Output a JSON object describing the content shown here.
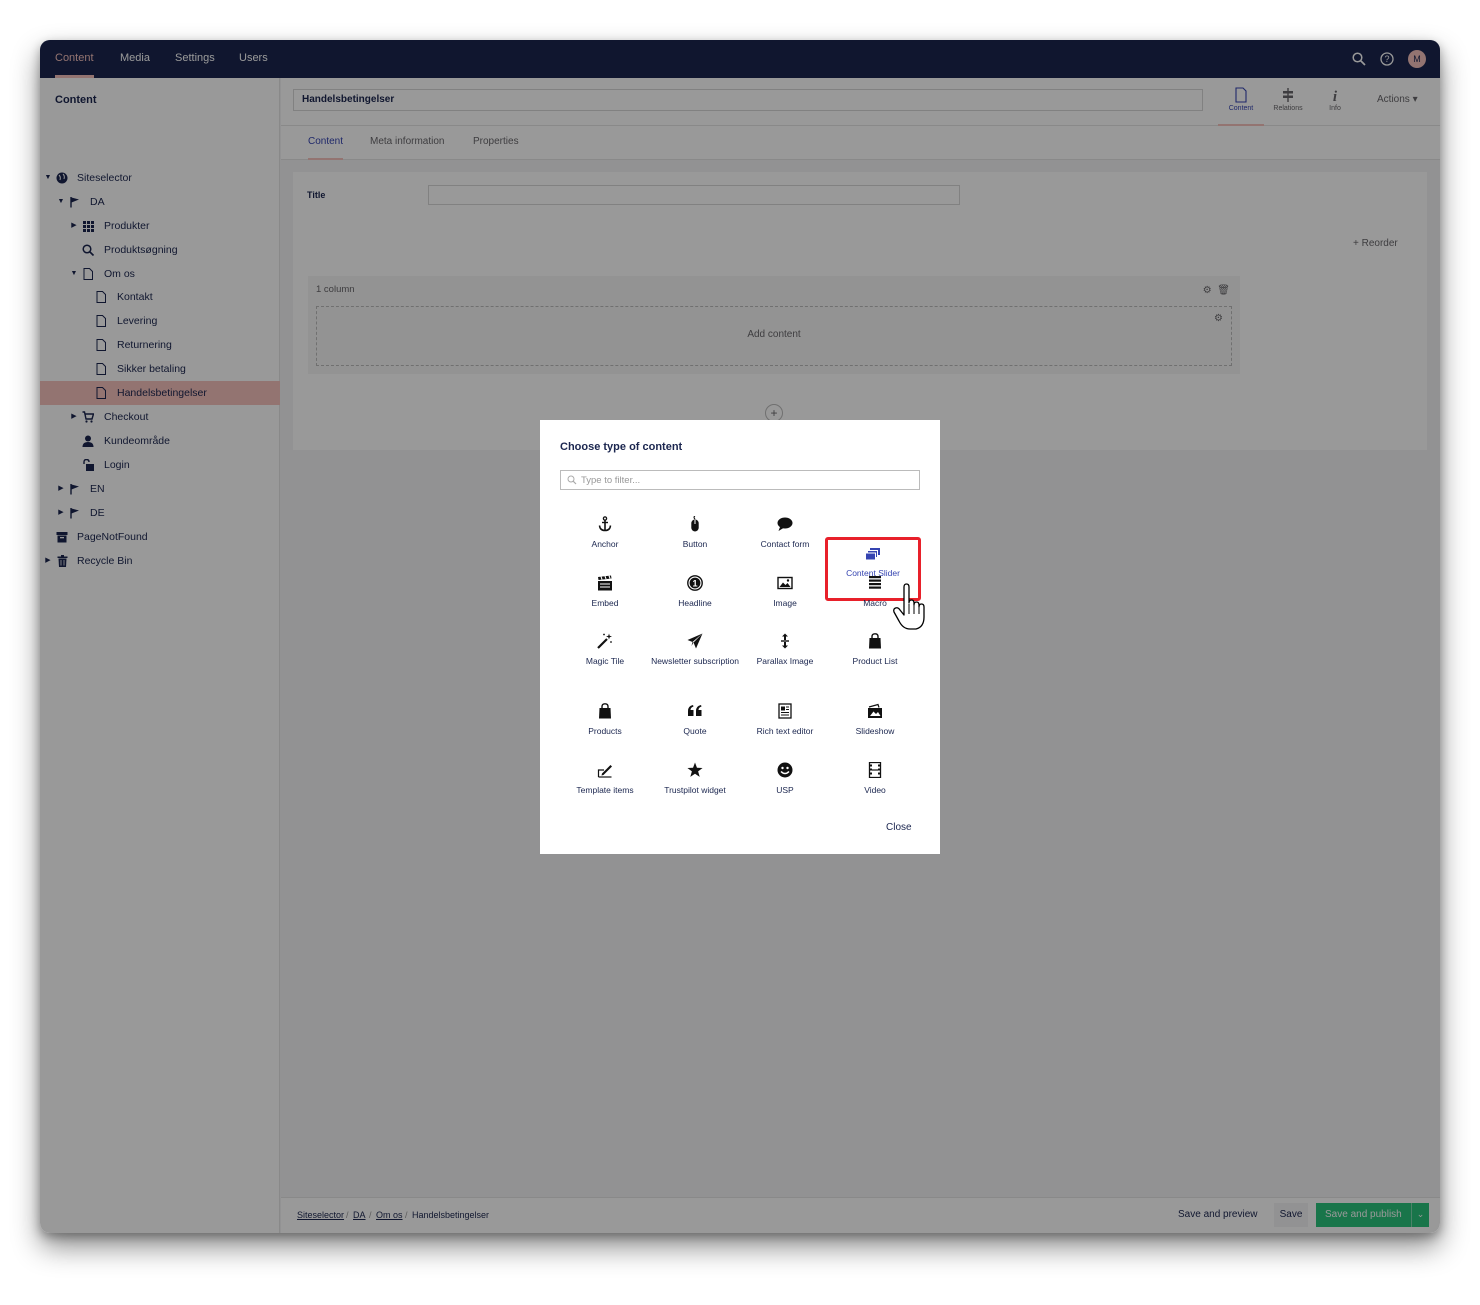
{
  "topnav": {
    "items": [
      "Content",
      "Media",
      "Settings",
      "Users"
    ],
    "avatar_initial": "M"
  },
  "sidebar": {
    "title": "Content",
    "items": [
      {
        "label": "Siteselector",
        "icon": "globe-icon"
      },
      {
        "label": "DA",
        "icon": "flag-icon"
      },
      {
        "label": "Produkter",
        "icon": "grid-icon"
      },
      {
        "label": "Produktsøgning",
        "icon": "search-icon"
      },
      {
        "label": "Om os",
        "icon": "document-icon"
      },
      {
        "label": "Kontakt",
        "icon": "document-icon"
      },
      {
        "label": "Levering",
        "icon": "document-icon"
      },
      {
        "label": "Returnering",
        "icon": "document-icon"
      },
      {
        "label": "Sikker betaling",
        "icon": "document-icon"
      },
      {
        "label": "Handelsbetingelser",
        "icon": "document-icon"
      },
      {
        "label": "Checkout",
        "icon": "cart-icon"
      },
      {
        "label": "Kundeområde",
        "icon": "user-icon"
      },
      {
        "label": "Login",
        "icon": "unlock-icon"
      },
      {
        "label": "EN",
        "icon": "flag-icon"
      },
      {
        "label": "DE",
        "icon": "flag-icon"
      },
      {
        "label": "PageNotFound",
        "icon": "archive-icon"
      },
      {
        "label": "Recycle Bin",
        "icon": "trash-icon"
      }
    ]
  },
  "header": {
    "node_name": "Handelsbetingelser",
    "apps": [
      "Content",
      "Relations",
      "Info"
    ],
    "actions_label": "Actions ▾"
  },
  "subtabs": [
    "Content",
    "Meta information",
    "Properties"
  ],
  "editor": {
    "title_label": "Title",
    "reorder_label": "Reorder",
    "row_label": "1 column",
    "add_content_label": "Add content"
  },
  "dialog": {
    "title": "Choose type of content",
    "filter_placeholder": "Type to filter...",
    "items": [
      {
        "label": "Anchor",
        "icon": "anchor-icon"
      },
      {
        "label": "Button",
        "icon": "mouse-icon"
      },
      {
        "label": "Contact form",
        "icon": "chat-bubble-icon"
      },
      {
        "label": "Content Slider",
        "icon": "slides-icon"
      },
      {
        "label": "Embed",
        "icon": "clapperboard-icon"
      },
      {
        "label": "Headline",
        "icon": "number-one-circle-icon"
      },
      {
        "label": "Image",
        "icon": "picture-icon"
      },
      {
        "label": "Macro",
        "icon": "macro-icon"
      },
      {
        "label": "Magic Tile",
        "icon": "magic-wand-icon"
      },
      {
        "label": "Newsletter subscription",
        "icon": "paper-plane-icon"
      },
      {
        "label": "Parallax Image",
        "icon": "parallax-arrows-icon"
      },
      {
        "label": "Product List",
        "icon": "shopping-bag-icon"
      },
      {
        "label": "Products",
        "icon": "shopping-bag-icon"
      },
      {
        "label": "Quote",
        "icon": "quote-icon"
      },
      {
        "label": "Rich text editor",
        "icon": "newspaper-icon"
      },
      {
        "label": "Slideshow",
        "icon": "photo-stack-icon"
      },
      {
        "label": "Template items",
        "icon": "edit-pencil-icon"
      },
      {
        "label": "Trustpilot widget",
        "icon": "star-icon"
      },
      {
        "label": "USP",
        "icon": "smiley-icon"
      },
      {
        "label": "Video",
        "icon": "film-icon"
      }
    ],
    "close_label": "Close"
  },
  "footer": {
    "breadcrumb": [
      "Siteselector",
      "DA",
      "Om os",
      "Handelsbetingelser"
    ],
    "save_preview_label": "Save and preview",
    "save_label": "Save",
    "publish_label": "Save and publish",
    "publish_caret": "⌄"
  },
  "colors": {
    "topbar": "#1b264f",
    "accent_pink": "#f5c1bc",
    "highlight_red": "#e8202a",
    "publish_green": "#2bc37c",
    "link_blue": "#3544b1"
  }
}
